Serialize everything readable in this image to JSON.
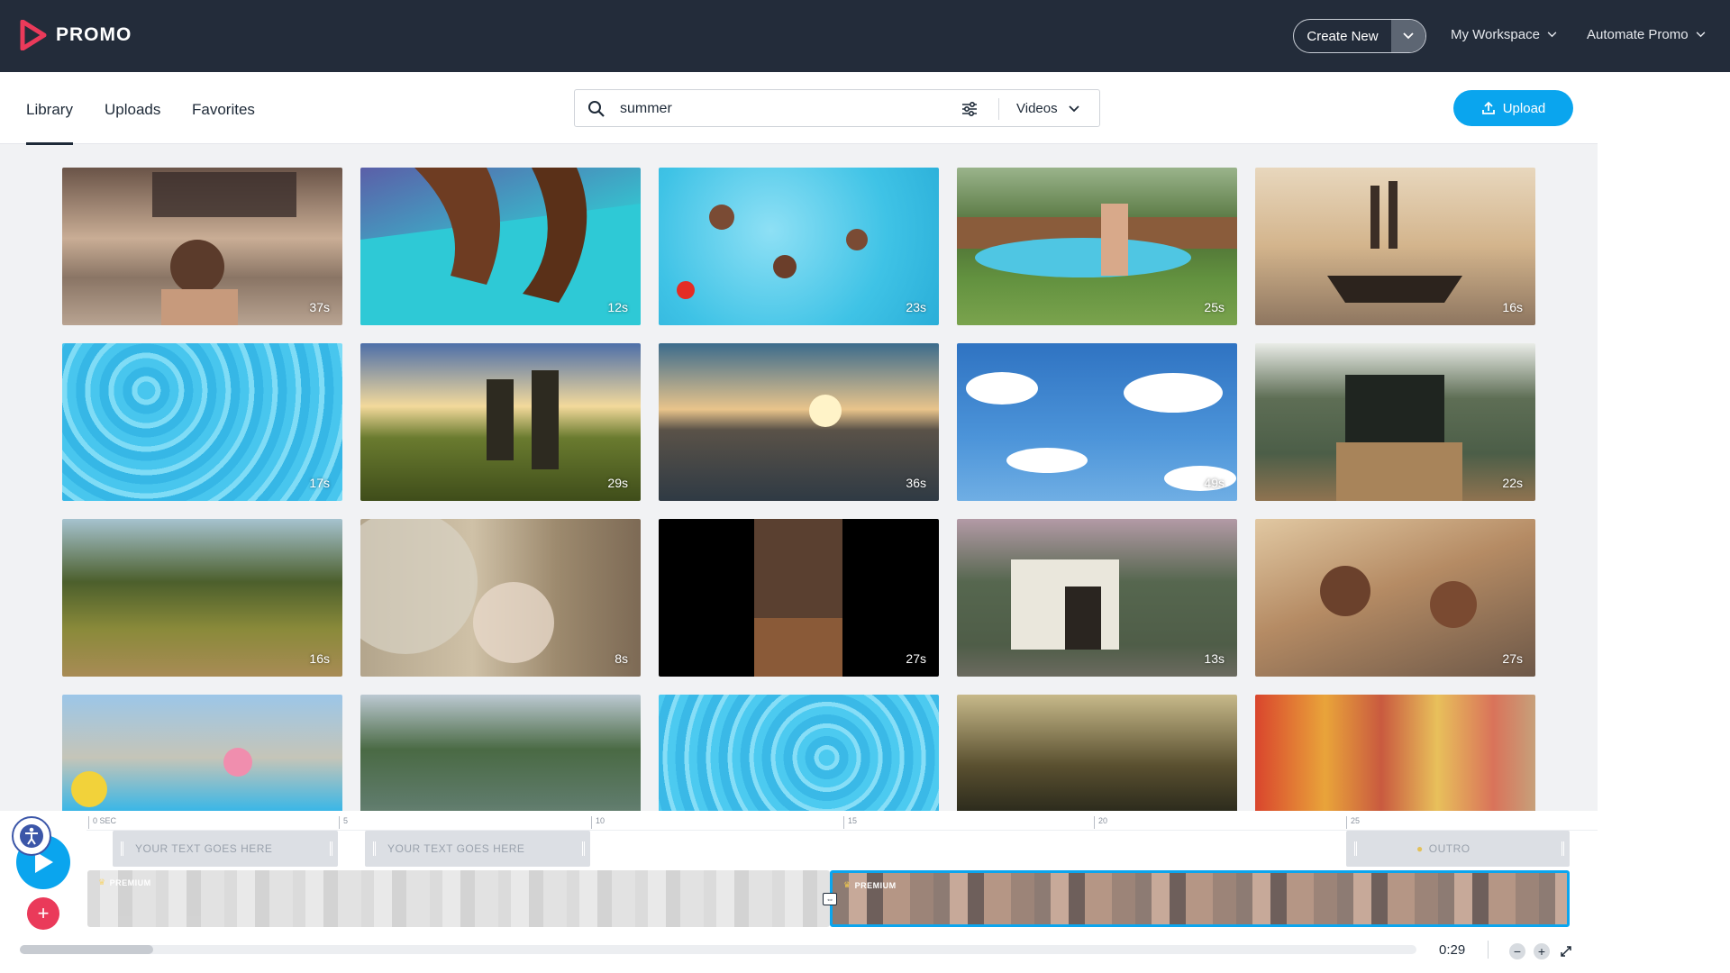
{
  "app": {
    "logo_text": "PROMO",
    "brand_color": "#ea3a5a"
  },
  "topbar": {
    "create_new": "Create New",
    "workspace": "My Workspace",
    "automate": "Automate Promo"
  },
  "subheader": {
    "tabs": [
      {
        "label": "Library",
        "active": true
      },
      {
        "label": "Uploads",
        "active": false
      },
      {
        "label": "Favorites",
        "active": false
      }
    ],
    "search": {
      "value": "summer",
      "placeholder": ""
    },
    "media_type": "Videos",
    "upload_label": "Upload"
  },
  "grid": {
    "items": [
      {
        "duration": "37s",
        "scene": "festival crowd"
      },
      {
        "duration": "12s",
        "scene": "paddleboard"
      },
      {
        "duration": "23s",
        "scene": "pool swimmers"
      },
      {
        "duration": "25s",
        "scene": "backyard pool"
      },
      {
        "duration": "16s",
        "scene": "boat sunset"
      },
      {
        "duration": "17s",
        "scene": "pool water"
      },
      {
        "duration": "29s",
        "scene": "meadow sunset"
      },
      {
        "duration": "36s",
        "scene": "ocean sunset"
      },
      {
        "duration": "49s",
        "scene": "blue sky clouds"
      },
      {
        "duration": "22s",
        "scene": "porch couple"
      },
      {
        "duration": "16s",
        "scene": "hill trail"
      },
      {
        "duration": "8s",
        "scene": "fan living room"
      },
      {
        "duration": "27s",
        "scene": "concert hands"
      },
      {
        "duration": "13s",
        "scene": "house dog"
      },
      {
        "duration": "27s",
        "scene": "festival dancing"
      },
      {
        "duration": "",
        "scene": "pool party"
      },
      {
        "duration": "",
        "scene": "lake kayaks"
      },
      {
        "duration": "",
        "scene": "pool water"
      },
      {
        "duration": "",
        "scene": "forest sunset"
      },
      {
        "duration": "",
        "scene": "colorful village"
      }
    ]
  },
  "timeline": {
    "ticks": [
      "0 SEC",
      "5",
      "10",
      "15",
      "20",
      "25"
    ],
    "text_tracks": [
      "YOUR TEXT GOES HERE",
      "YOUR TEXT GOES HERE"
    ],
    "outro_label": "OUTRO",
    "premium_label": "PREMIUM",
    "time": "0:29",
    "accent": "#0aa5ee"
  }
}
